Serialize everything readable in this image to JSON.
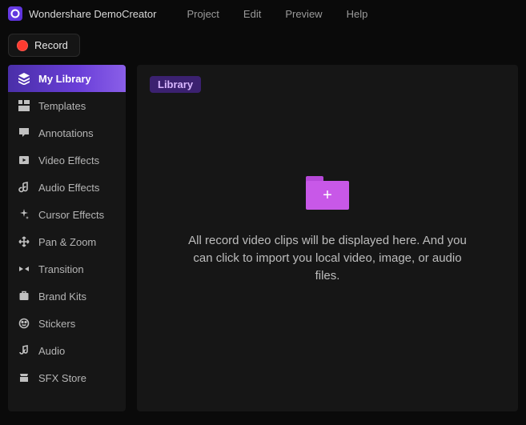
{
  "app": {
    "title": "Wondershare DemoCreator"
  },
  "menu": {
    "items": [
      {
        "label": "Project"
      },
      {
        "label": "Edit"
      },
      {
        "label": "Preview"
      },
      {
        "label": "Help"
      }
    ]
  },
  "toolbar": {
    "record_label": "Record"
  },
  "sidebar": {
    "items": [
      {
        "label": "My Library",
        "icon": "layers-icon",
        "active": true
      },
      {
        "label": "Templates",
        "icon": "templates-icon",
        "active": false
      },
      {
        "label": "Annotations",
        "icon": "annotations-icon",
        "active": false
      },
      {
        "label": "Video Effects",
        "icon": "video-effects-icon",
        "active": false
      },
      {
        "label": "Audio Effects",
        "icon": "audio-effects-icon",
        "active": false
      },
      {
        "label": "Cursor Effects",
        "icon": "cursor-effects-icon",
        "active": false
      },
      {
        "label": "Pan & Zoom",
        "icon": "pan-zoom-icon",
        "active": false
      },
      {
        "label": "Transition",
        "icon": "transition-icon",
        "active": false
      },
      {
        "label": "Brand Kits",
        "icon": "brand-kits-icon",
        "active": false
      },
      {
        "label": "Stickers",
        "icon": "stickers-icon",
        "active": false
      },
      {
        "label": "Audio",
        "icon": "audio-icon",
        "active": false
      },
      {
        "label": "SFX Store",
        "icon": "sfx-store-icon",
        "active": false
      }
    ]
  },
  "main": {
    "tag_label": "Library",
    "empty_text": "All record video clips will be displayed here. And you can click to import you local video, image, or audio files."
  },
  "colors": {
    "accent_purple": "#6a3fd8",
    "folder_pink": "#c858e8",
    "record_red": "#ff3b30",
    "bg_dark": "#0a0a0a",
    "panel_dark": "#161616"
  }
}
